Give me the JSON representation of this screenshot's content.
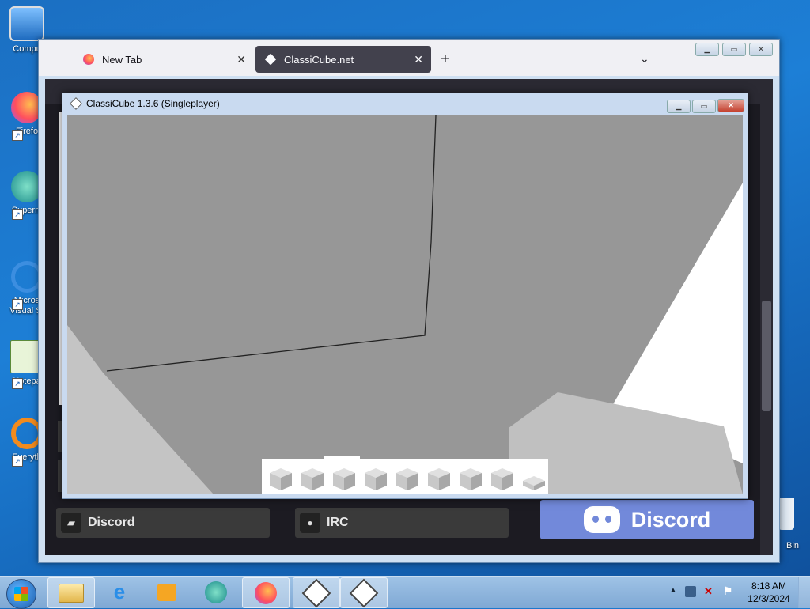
{
  "desktop": {
    "icons": [
      {
        "label": "Compu",
        "name": "computer"
      },
      {
        "label": "Firefo",
        "name": "firefox"
      },
      {
        "label": "Superm",
        "name": "supermium"
      },
      {
        "label": "Micros Visual St",
        "name": "visual-studio"
      },
      {
        "label": "Notepa",
        "name": "notepad"
      },
      {
        "label": "Everyth",
        "name": "everything"
      }
    ],
    "recycle_bin_label": "Bin"
  },
  "firefox": {
    "tabs": [
      {
        "label": "New Tab"
      },
      {
        "label": "ClassiCube.net"
      }
    ],
    "new_tab_symbol": "+",
    "tab_list_symbol": "⌄",
    "close_symbol": "✕",
    "page": {
      "buttons": [
        {
          "label": "Discord",
          "icon": "chat-icon"
        },
        {
          "label": "IRC",
          "icon": "globe-icon"
        }
      ],
      "discord_banner": "Discord"
    }
  },
  "classicube": {
    "title": "ClassiCube 1.3.6 (Singleplayer)",
    "hotbar_slots": 9,
    "selected_slot": 3
  },
  "taskbar": {
    "time": "8:18 AM",
    "date": "12/3/2024",
    "apps": [
      "explorer",
      "internet-explorer",
      "media-player",
      "browser",
      "firefox",
      "classicube",
      "classicube"
    ]
  },
  "colors": {
    "sky": "#979797",
    "wall": "#ffffff",
    "floor": "#c2c2c2",
    "discord": "#7289da"
  }
}
